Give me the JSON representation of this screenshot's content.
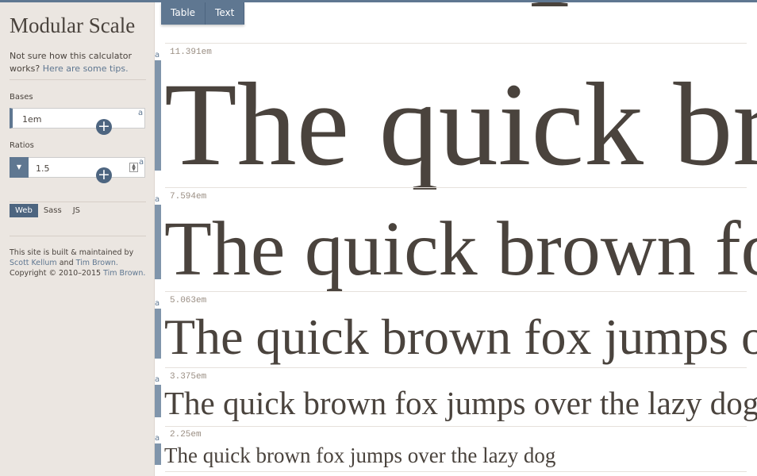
{
  "sidebar": {
    "title": "Modular Scale",
    "intro": "Not sure how this calculator works?",
    "tips_link": "Here are some tips.",
    "bases_label": "Bases",
    "bases_value": "1em",
    "ratios_label": "Ratios",
    "ratios_value": "1.5",
    "a_mark": "a",
    "output_tabs": [
      "Web",
      "Sass",
      "JS"
    ],
    "active_output_tab": "Web",
    "footer": {
      "line1": "This site is built & maintained by",
      "author1": "Scott Kellum",
      "and": "and",
      "author2": "Tim Brown.",
      "copyright": "Copyright © 2010–2015",
      "copyright_link": "Tim Brown."
    }
  },
  "main": {
    "tabs": [
      "Table",
      "Text"
    ],
    "sample_text": "The quick brown fox jumps over the lazy dog",
    "rows": [
      {
        "size": "11.391em"
      },
      {
        "size": "7.594em"
      },
      {
        "size": "5.063em"
      },
      {
        "size": "3.375em"
      },
      {
        "size": "2.25em"
      }
    ]
  },
  "colors": {
    "accent": "#5f7791",
    "text": "#4a433d",
    "sidebar_bg": "#ebe6e1"
  }
}
